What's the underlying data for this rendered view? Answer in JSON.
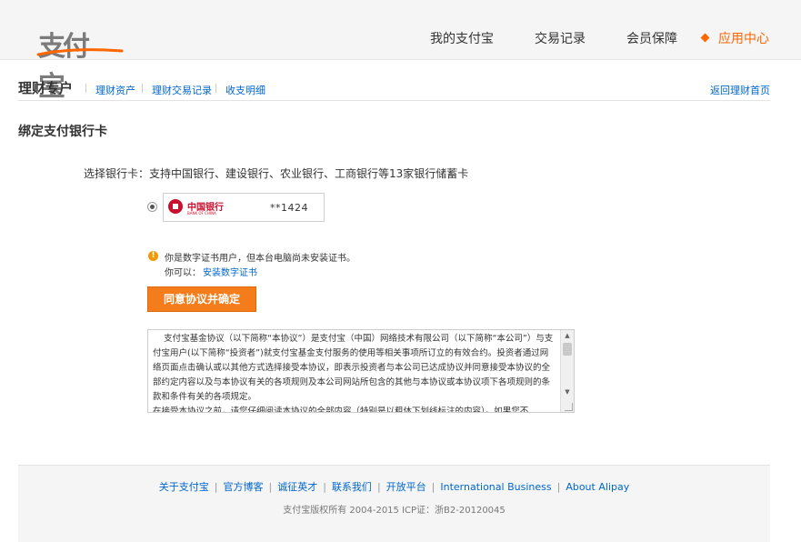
{
  "header": {
    "logo": "支付宝",
    "nav": [
      {
        "label": "我的支付宝",
        "active": false
      },
      {
        "label": "交易记录",
        "active": false
      },
      {
        "label": "会员保障",
        "active": false
      },
      {
        "label": "应用中心",
        "active": true
      }
    ]
  },
  "subnav": {
    "title": "理财专户",
    "links": [
      "理财资产",
      "理财交易记录",
      "收支明细"
    ],
    "back": "返回理财首页"
  },
  "section_title": "绑定支付银行卡",
  "select_label": "选择银行卡：支持中国银行、建设银行、农业银行、工商银行等13家银行储蓄卡",
  "card": {
    "bank_name_cn": "中国银行",
    "bank_name_en": "BANK OF CHINA",
    "number": "**1424",
    "selected": true
  },
  "warning": {
    "text": "你是数字证书用户，但本台电脑尚未安装证书。",
    "can_label": "你可以：",
    "install_link": "安装数字证书"
  },
  "agree_button": "同意协议并确定",
  "agreement_text": "    支付宝基金协议（以下简称“本协议”）是支付宝（中国）网络技术有限公司（以下简称“本公司”）与支付宝用户(以下简称“投资者”)就支付宝基金支付服务的使用等相关事项所订立的有效合约。投资者通过网络页面点击确认或以其他方式选择接受本协议，即表示投资者与本公司已达成协议并同意接受本协议的全部约定内容以及与本协议有关的各项规则及本公司网站所包含的其他与本协议或本协议项下各项规则的条款和条件有关的各项规定。\n在接受本协议之前，请您仔细阅读本协议的全部内容（特别是以粗体下划线标注的内容）。如果您不",
  "footer": {
    "links": [
      "关于支付宝",
      "官方博客",
      "诚征英才",
      "联系我们",
      "开放平台",
      "International Business",
      "About Alipay"
    ],
    "copyright": "支付宝版权所有 2004-2015 ICP证：浙B2-20120045"
  },
  "colors": {
    "accent": "#ff6600",
    "link": "#0066cc",
    "button": "#f47c1a",
    "warning": "#f39800",
    "boc_red": "#c8102e"
  }
}
